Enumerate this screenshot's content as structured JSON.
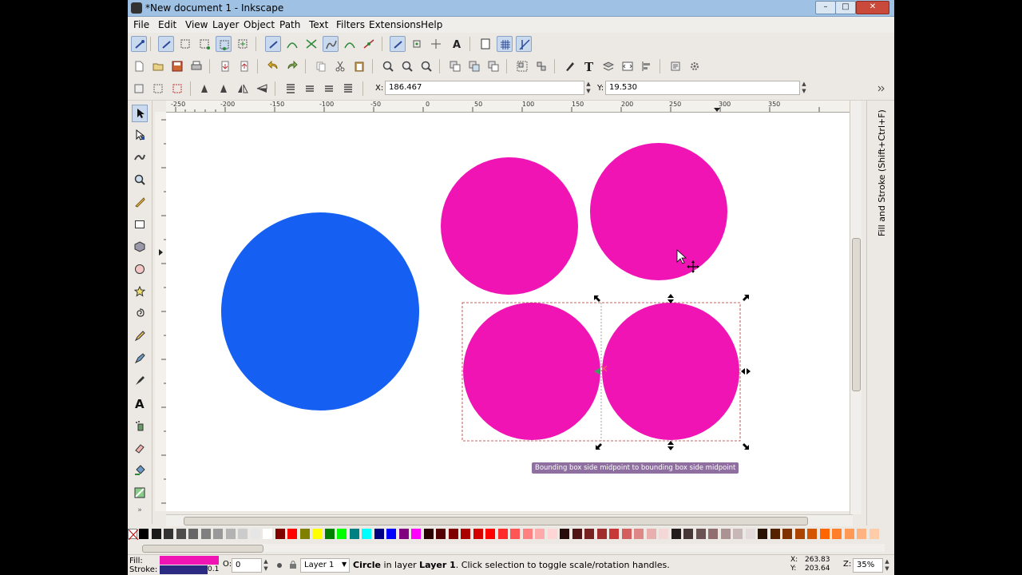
{
  "window": {
    "title": "*New document 1 - Inkscape",
    "controls": {
      "minimize": "–",
      "maximize": "□",
      "close": "✕"
    }
  },
  "menubar": [
    "File",
    "Edit",
    "View",
    "Layer",
    "Object",
    "Path",
    "Text",
    "Filters",
    "Extensions",
    "Help"
  ],
  "tool_controls": {
    "x_label": "X:",
    "x_value": "186.467",
    "y_label": "Y:",
    "y_value": "19.530"
  },
  "ruler": {
    "h_ticks": [
      "-250",
      "-200",
      "-150",
      "-100",
      "-50",
      "0",
      "50",
      "100",
      "150",
      "200",
      "250",
      "300",
      "350"
    ]
  },
  "canvas": {
    "tooltip": "Bounding box side midpoint to bounding box side midpoint",
    "colors": {
      "blue": "#1560f2",
      "magenta": "#f014b5"
    }
  },
  "dock": {
    "label": "Fill and Stroke (Shift+Ctrl+F)"
  },
  "palette": [
    "#000000",
    "#1a1a1a",
    "#333333",
    "#4d4d4d",
    "#666666",
    "#808080",
    "#999999",
    "#b3b3b3",
    "#cccccc",
    "#e6e6e6",
    "#ffffff",
    "#800000",
    "#ff0000",
    "#808000",
    "#ffff00",
    "#008000",
    "#00ff00",
    "#008080",
    "#00ffff",
    "#000080",
    "#0000ff",
    "#800080",
    "#ff00ff",
    "#2b0000",
    "#550000",
    "#800000",
    "#aa0000",
    "#d40000",
    "#ff0000",
    "#ff2a2a",
    "#ff5555",
    "#ff8080",
    "#ffaaaa",
    "#ffd5d5",
    "#280b0b",
    "#501616",
    "#782121",
    "#a02c2c",
    "#c83737",
    "#d35f5f",
    "#de8787",
    "#e9afaf",
    "#f4d7d7",
    "#241c1c",
    "#483737",
    "#6c5353",
    "#916f6f",
    "#ac9393",
    "#c8b7b7",
    "#e3dbdb",
    "#2b1100",
    "#552200",
    "#803300",
    "#aa4400",
    "#d45500",
    "#ff6600",
    "#ff7f2a",
    "#ff9955",
    "#ffb380",
    "#ffccaa"
  ],
  "status": {
    "fill_label": "Fill:",
    "stroke_label": "Stroke:",
    "stroke_width": "0.1",
    "opacity_label": "O:",
    "opacity_value": "0",
    "layer": "Layer 1",
    "msg_obj": "Circle",
    "msg_mid": " in layer ",
    "msg_layer": "Layer 1",
    "msg_end": ". Click selection to toggle scale/rotation handles.",
    "coord_x_label": "X:",
    "coord_x": "263.83",
    "coord_y_label": "Y:",
    "coord_y": "203.64",
    "zoom_label": "Z:",
    "zoom_value": "35%",
    "fill_color": "#f014b5",
    "stroke_color": "#2a2a80"
  }
}
